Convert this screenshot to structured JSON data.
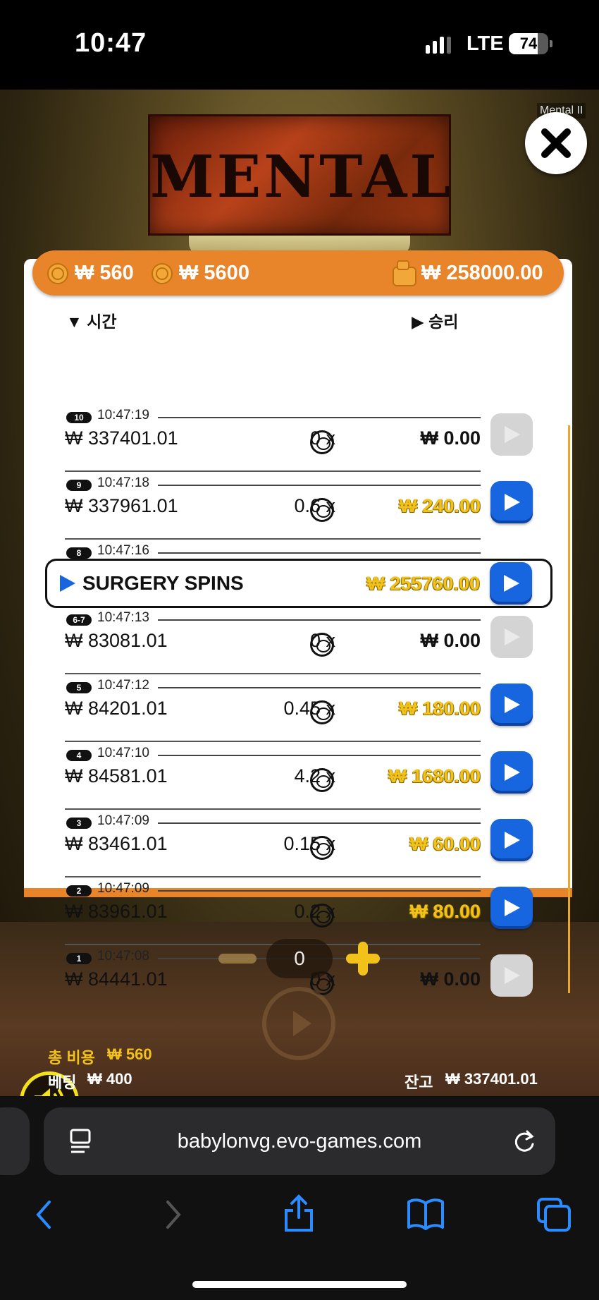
{
  "status": {
    "time": "10:47",
    "network": "LTE",
    "battery": "74",
    "battery_level": 0.74
  },
  "game": {
    "title": "Mental II",
    "logo_text": "MENTAL II",
    "summary": {
      "bet1": "₩ 560",
      "bet2": "₩ 5600",
      "balance": "₩ 258000.00"
    },
    "headers": {
      "time": "시간",
      "win": "승리"
    },
    "rows": [
      {
        "num": "10",
        "time": "10:47:19",
        "balance": "₩ 337401.01",
        "mult": "0 x",
        "win": "₩ 0.00",
        "gold": false,
        "active": false
      },
      {
        "num": "9",
        "time": "10:47:18",
        "balance": "₩ 337961.01",
        "mult": "0.6 x",
        "win": "₩ 240.00",
        "gold": true,
        "active": true
      },
      {
        "num": "8",
        "time": "10:47:16",
        "label": "SURGERY SPINS",
        "win": "₩ 255760.00",
        "gold": true,
        "active": true
      },
      {
        "num": "6-7",
        "time": "10:47:13",
        "balance": "₩ 83081.01",
        "mult": "0 x",
        "win": "₩ 0.00",
        "gold": false,
        "active": false
      },
      {
        "num": "5",
        "time": "10:47:12",
        "balance": "₩ 84201.01",
        "mult": "0.45 x",
        "win": "₩ 180.00",
        "gold": true,
        "active": true
      },
      {
        "num": "4",
        "time": "10:47:10",
        "balance": "₩ 84581.01",
        "mult": "4.2 x",
        "win": "₩ 1680.00",
        "gold": true,
        "active": true
      },
      {
        "num": "3",
        "time": "10:47:09",
        "balance": "₩ 83461.01",
        "mult": "0.15 x",
        "win": "₩ 60.00",
        "gold": true,
        "active": true
      },
      {
        "num": "2",
        "time": "10:47:09",
        "balance": "₩ 83961.01",
        "mult": "0.2 x",
        "win": "₩ 80.00",
        "gold": true,
        "active": true
      },
      {
        "num": "1",
        "time": "10:47:08",
        "balance": "₩ 84441.01",
        "mult": "0 x",
        "win": "₩ 0.00",
        "gold": false,
        "active": false
      }
    ],
    "stepper_value": "0",
    "footer": {
      "total_label": "총 비용",
      "total_value": "₩ 560",
      "bet_label": "베팅",
      "bet_value": "₩ 400",
      "balance_label": "잔고",
      "balance_value": "₩ 337401.01"
    }
  },
  "browser": {
    "url": "babylonvg.evo-games.com"
  },
  "colors": {
    "orange": "#e8852a",
    "blue": "#1766e0",
    "gold": "#f2c21a"
  }
}
